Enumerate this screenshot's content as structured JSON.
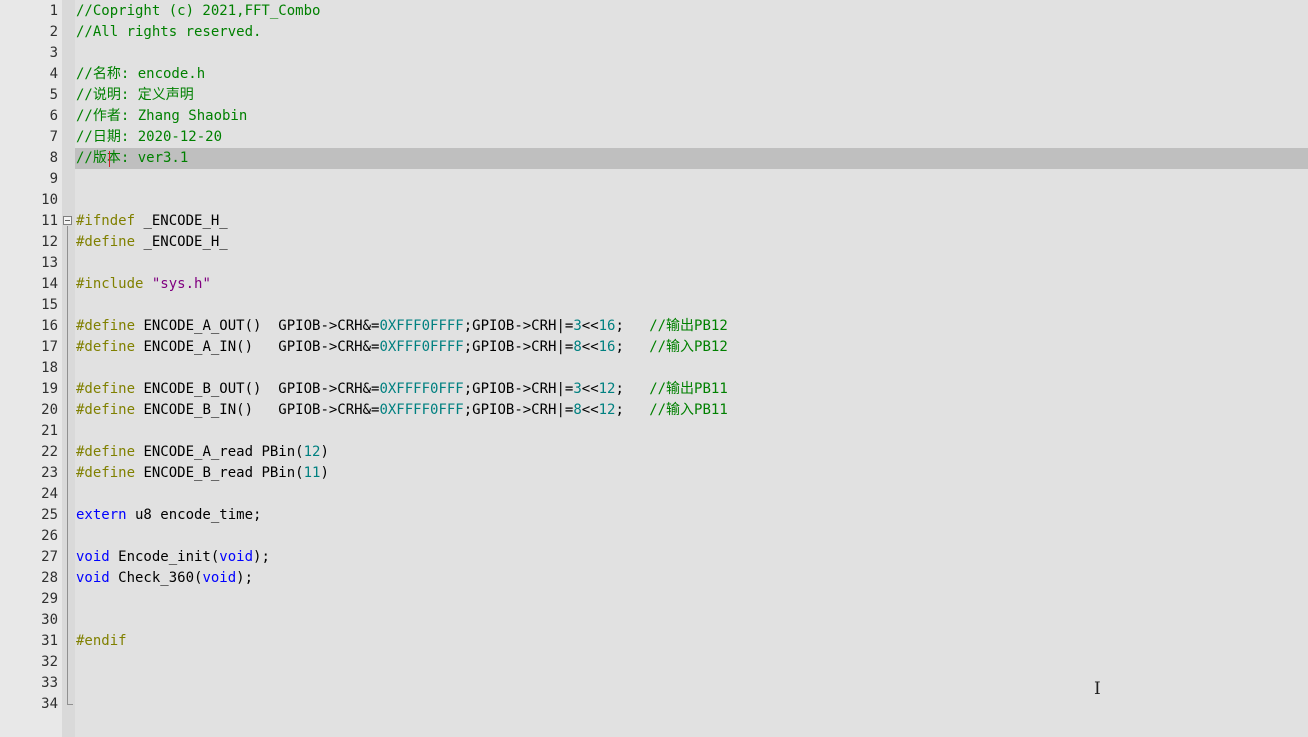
{
  "colors": {
    "comment": "#008000",
    "preprocessor": "#808000",
    "keyword": "#0000ff",
    "number": "#008080",
    "string": "#800080",
    "default": "#000000",
    "current_line": "#bfbfbf"
  },
  "editor": {
    "current_line": 8,
    "fold_start_line": 11,
    "fold_end_line": 34,
    "mouse_cursor_icon": "text-ibeam-icon",
    "fold_icon": "fold-collapse-icon"
  },
  "lines": [
    {
      "n": "1",
      "tokens": [
        {
          "t": "comment",
          "v": "//Copright (c) 2021,FFT_Combo"
        }
      ]
    },
    {
      "n": "2",
      "tokens": [
        {
          "t": "comment",
          "v": "//All rights reserved."
        }
      ]
    },
    {
      "n": "3",
      "tokens": []
    },
    {
      "n": "4",
      "tokens": [
        {
          "t": "comment",
          "v": "//名称: encode.h"
        }
      ]
    },
    {
      "n": "5",
      "tokens": [
        {
          "t": "comment",
          "v": "//说明: 定义声明"
        }
      ]
    },
    {
      "n": "6",
      "tokens": [
        {
          "t": "comment",
          "v": "//作者: Zhang Shaobin"
        }
      ]
    },
    {
      "n": "7",
      "tokens": [
        {
          "t": "comment",
          "v": "//日期: 2020-12-20"
        }
      ]
    },
    {
      "n": "8",
      "tokens": [
        {
          "t": "comment",
          "v": "//版本: ver3.1"
        }
      ]
    },
    {
      "n": "9",
      "tokens": []
    },
    {
      "n": "10",
      "tokens": []
    },
    {
      "n": "11",
      "tokens": [
        {
          "t": "preprocessor",
          "v": "#ifndef"
        },
        {
          "t": "default",
          "v": " _ENCODE_H_"
        }
      ]
    },
    {
      "n": "12",
      "tokens": [
        {
          "t": "preprocessor",
          "v": "#define"
        },
        {
          "t": "default",
          "v": " _ENCODE_H_"
        }
      ]
    },
    {
      "n": "13",
      "tokens": []
    },
    {
      "n": "14",
      "tokens": [
        {
          "t": "preprocessor",
          "v": "#include"
        },
        {
          "t": "default",
          "v": " "
        },
        {
          "t": "string",
          "v": "\"sys.h\""
        }
      ]
    },
    {
      "n": "15",
      "tokens": []
    },
    {
      "n": "16",
      "tokens": [
        {
          "t": "preprocessor",
          "v": "#define"
        },
        {
          "t": "default",
          "v": " ENCODE_A_OUT()  GPIOB->CRH&="
        },
        {
          "t": "number",
          "v": "0XFFF0FFFF"
        },
        {
          "t": "default",
          "v": ";GPIOB->CRH|="
        },
        {
          "t": "number",
          "v": "3"
        },
        {
          "t": "default",
          "v": "<<"
        },
        {
          "t": "number",
          "v": "16"
        },
        {
          "t": "default",
          "v": ";   "
        },
        {
          "t": "comment",
          "v": "//输出PB12"
        }
      ]
    },
    {
      "n": "17",
      "tokens": [
        {
          "t": "preprocessor",
          "v": "#define"
        },
        {
          "t": "default",
          "v": " ENCODE_A_IN()   GPIOB->CRH&="
        },
        {
          "t": "number",
          "v": "0XFFF0FFFF"
        },
        {
          "t": "default",
          "v": ";GPIOB->CRH|="
        },
        {
          "t": "number",
          "v": "8"
        },
        {
          "t": "default",
          "v": "<<"
        },
        {
          "t": "number",
          "v": "16"
        },
        {
          "t": "default",
          "v": ";   "
        },
        {
          "t": "comment",
          "v": "//输入PB12"
        }
      ]
    },
    {
      "n": "18",
      "tokens": []
    },
    {
      "n": "19",
      "tokens": [
        {
          "t": "preprocessor",
          "v": "#define"
        },
        {
          "t": "default",
          "v": " ENCODE_B_OUT()  GPIOB->CRH&="
        },
        {
          "t": "number",
          "v": "0XFFFF0FFF"
        },
        {
          "t": "default",
          "v": ";GPIOB->CRH|="
        },
        {
          "t": "number",
          "v": "3"
        },
        {
          "t": "default",
          "v": "<<"
        },
        {
          "t": "number",
          "v": "12"
        },
        {
          "t": "default",
          "v": ";   "
        },
        {
          "t": "comment",
          "v": "//输出PB11"
        }
      ]
    },
    {
      "n": "20",
      "tokens": [
        {
          "t": "preprocessor",
          "v": "#define"
        },
        {
          "t": "default",
          "v": " ENCODE_B_IN()   GPIOB->CRH&="
        },
        {
          "t": "number",
          "v": "0XFFFF0FFF"
        },
        {
          "t": "default",
          "v": ";GPIOB->CRH|="
        },
        {
          "t": "number",
          "v": "8"
        },
        {
          "t": "default",
          "v": "<<"
        },
        {
          "t": "number",
          "v": "12"
        },
        {
          "t": "default",
          "v": ";   "
        },
        {
          "t": "comment",
          "v": "//输入PB11"
        }
      ]
    },
    {
      "n": "21",
      "tokens": []
    },
    {
      "n": "22",
      "tokens": [
        {
          "t": "preprocessor",
          "v": "#define"
        },
        {
          "t": "default",
          "v": " ENCODE_A_read PBin("
        },
        {
          "t": "number",
          "v": "12"
        },
        {
          "t": "default",
          "v": ")"
        }
      ]
    },
    {
      "n": "23",
      "tokens": [
        {
          "t": "preprocessor",
          "v": "#define"
        },
        {
          "t": "default",
          "v": " ENCODE_B_read PBin("
        },
        {
          "t": "number",
          "v": "11"
        },
        {
          "t": "default",
          "v": ")"
        }
      ]
    },
    {
      "n": "24",
      "tokens": []
    },
    {
      "n": "25",
      "tokens": [
        {
          "t": "keyword",
          "v": "extern"
        },
        {
          "t": "default",
          "v": " u8 encode_time;"
        }
      ]
    },
    {
      "n": "26",
      "tokens": []
    },
    {
      "n": "27",
      "tokens": [
        {
          "t": "keyword",
          "v": "void"
        },
        {
          "t": "default",
          "v": " Encode_init("
        },
        {
          "t": "keyword",
          "v": "void"
        },
        {
          "t": "default",
          "v": ");"
        }
      ]
    },
    {
      "n": "28",
      "tokens": [
        {
          "t": "keyword",
          "v": "void"
        },
        {
          "t": "default",
          "v": " Check_360("
        },
        {
          "t": "keyword",
          "v": "void"
        },
        {
          "t": "default",
          "v": ");"
        }
      ]
    },
    {
      "n": "29",
      "tokens": []
    },
    {
      "n": "30",
      "tokens": []
    },
    {
      "n": "31",
      "tokens": [
        {
          "t": "preprocessor",
          "v": "#endif"
        }
      ]
    },
    {
      "n": "32",
      "tokens": []
    },
    {
      "n": "33",
      "tokens": []
    },
    {
      "n": "34",
      "tokens": []
    }
  ]
}
